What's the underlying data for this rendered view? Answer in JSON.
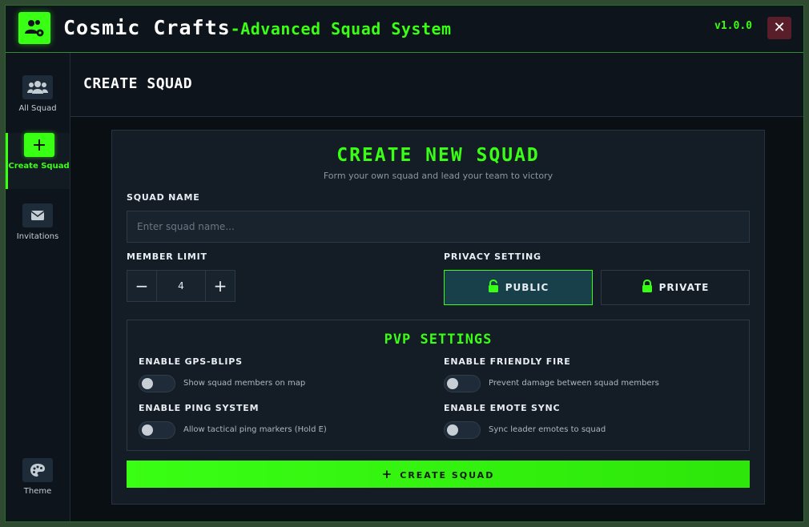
{
  "app": {
    "title": "Cosmic Crafts",
    "subtitle": "-Advanced Squad System",
    "version": "v1.0.0",
    "close_glyph": "✕"
  },
  "sidebar": {
    "items": [
      {
        "label": "All Squad",
        "icon": "users-icon"
      },
      {
        "label": "Create Squad",
        "icon": "plus-icon",
        "active": true
      },
      {
        "label": "Invitations",
        "icon": "envelope-icon"
      },
      {
        "label": "Theme",
        "icon": "palette-icon"
      }
    ]
  },
  "page": {
    "title": "CREATE SQUAD"
  },
  "form": {
    "title": "CREATE NEW SQUAD",
    "subtitle": "Form your own squad and lead your team to victory",
    "squad_name_label": "SQUAD NAME",
    "squad_name_placeholder": "Enter squad name...",
    "squad_name_value": "",
    "member_limit_label": "MEMBER LIMIT",
    "member_limit_value": "4",
    "minus_glyph": "−",
    "plus_glyph": "+",
    "privacy_label": "PRIVACY SETTING",
    "privacy_options": [
      {
        "label": "PUBLIC",
        "icon": "unlock-icon",
        "selected": true
      },
      {
        "label": "PRIVATE",
        "icon": "lock-icon",
        "selected": false
      }
    ],
    "pvp": {
      "title": "PVP SETTINGS",
      "settings": [
        {
          "label": "ENABLE GPS-BLIPS",
          "desc": "Show squad members on map",
          "enabled": false
        },
        {
          "label": "ENABLE FRIENDLY FIRE",
          "desc": "Prevent damage between squad members",
          "enabled": false
        },
        {
          "label": "ENABLE PING SYSTEM",
          "desc": "Allow tactical ping markers (Hold E)",
          "enabled": false
        },
        {
          "label": "ENABLE EMOTE SYNC",
          "desc": "Sync leader emotes to squad",
          "enabled": false
        }
      ]
    },
    "submit_label": "CREATE SQUAD",
    "submit_glyph": "+"
  },
  "colors": {
    "accent": "#39ff14",
    "background": "#0c1117",
    "panel": "#141d26",
    "selected_option": "#17404a",
    "close_button": "#5a1e2a"
  }
}
